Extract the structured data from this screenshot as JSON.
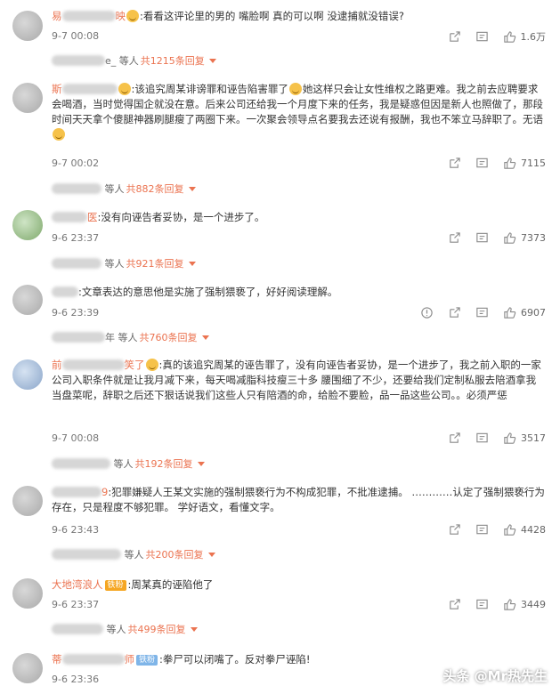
{
  "colors": {
    "accent": "#eb7350",
    "muted": "#808080"
  },
  "comments": [
    {
      "name_start": "易",
      "name_end": "映",
      "badge": "",
      "body": ":看看这评论里的男的  嘴脸啊 真的可以啊 没逮捕就没错误?",
      "time": "9-7 00:08",
      "likes": "1.6万",
      "reply_user": "e_",
      "reply_text": "等人",
      "reply_count": "共1215条回复"
    },
    {
      "name_start": "斯",
      "name_end": "",
      "badge": "",
      "body": ":该追究周某诽谤罪和诬告陷害罪了",
      "body2": "她这样只会让女性维权之路更难。我之前去应聘要求会喝酒，当时觉得国企就没在意。后来公司还给我一个月度下来的任务，我是疑惑但因是新人也照做了，那段时间天天拿个傻腿神器刷腿瘦了两圈下来。一次聚会领导点名要我去还说有报酬，我也不笨立马辞职了。无语",
      "time": "9-7 00:02",
      "likes": "7115",
      "reply_user": "",
      "reply_text": "等人",
      "reply_count": "共882条回复"
    },
    {
      "name_start": "",
      "name_end": "医",
      "badge": "",
      "body": ":没有向诬告者妥协，是一个进步了。",
      "time": "9-6 23:37",
      "likes": "7373",
      "reply_user": "",
      "reply_text": "等人",
      "reply_count": "共921条回复"
    },
    {
      "name_start": "",
      "name_end": "",
      "badge": "",
      "body": ":文章表达的意思他是实施了强制猥亵了，好好阅读理解。",
      "time": "9-6 23:39",
      "likes": "6907",
      "reply_user": "年",
      "reply_text": "等人",
      "reply_count": "共760条回复"
    },
    {
      "name_start": "前",
      "name_end": "笑了",
      "badge": "",
      "body": ":真的该追究周某的诬告罪了，没有向诬告者妥协，是一个进步了，我之前入职的一家公司入职条件就是让我月减下来，每天喝减脂科技瘦三十多 腰围细了不少，还要给我们定制私服去陪酒拿我当盘菜呢，辞职之后还下狠话说我们这些人只有陪酒的命，给脸不要脸，品一品这些公司。。必须严惩",
      "time": "9-7 00:08",
      "likes": "3517",
      "reply_user": "",
      "reply_text": "等人",
      "reply_count": "共192条回复"
    },
    {
      "name_start": "",
      "name_end": "9",
      "badge": "",
      "body": ":犯罪嫌疑人王某文实施的强制猥亵行为不构成犯罪，不批准逮捕。 …………认定了强制猥亵行为存在，只是程度不够犯罪。 学好语文，看懂文字。",
      "time": "9-6 23:43",
      "likes": "4428",
      "reply_user": "",
      "reply_text": "等人",
      "reply_count": "共200条回复"
    },
    {
      "name_start": "大地湾浪人",
      "name_end": "",
      "badge": "铁粉",
      "body": ":周某真的诬陷他了",
      "time": "9-6 23:37",
      "likes": "3449",
      "reply_user": "",
      "reply_text": "等人",
      "reply_count": "共499条回复"
    },
    {
      "name_start": "蒂",
      "name_end": "师",
      "badge": "铁粉",
      "body": ":拳尸可以闭嘴了。反对拳尸诬陷!",
      "time": "9-6 23:36",
      "likes": "",
      "reply_user": "",
      "reply_text": "",
      "reply_count": ""
    }
  ],
  "watermark": "头条 @Mr热先生",
  "icons": [
    "share-icon",
    "comment-icon",
    "like-icon",
    "more-icon"
  ]
}
